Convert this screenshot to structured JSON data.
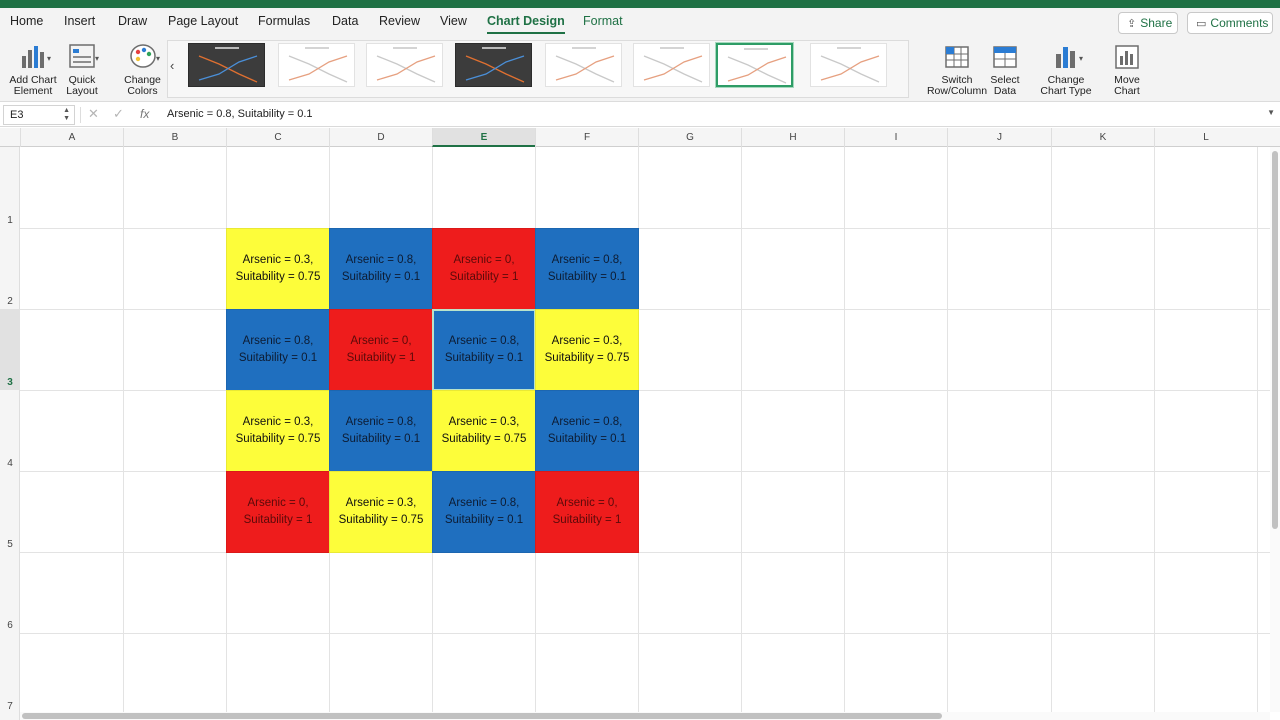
{
  "tabs": [
    "Home",
    "Insert",
    "Draw",
    "Page Layout",
    "Formulas",
    "Data",
    "Review",
    "View",
    "Chart Design",
    "Format"
  ],
  "active_tab": "Chart Design",
  "share_label": "Share",
  "comments_label": "Comments",
  "ribbon": {
    "add_chart_element": "Add Chart\nElement",
    "quick_layout": "Quick\nLayout",
    "change_colors": "Change\nColors",
    "switch_row_column": "Switch\nRow/Column",
    "select_data": "Select\nData",
    "change_chart_type": "Change\nChart Type",
    "move_chart": "Move\nChart"
  },
  "chart_style_thumbnails": [
    {
      "theme": "dark"
    },
    {
      "theme": "light"
    },
    {
      "theme": "light"
    },
    {
      "theme": "dark"
    },
    {
      "theme": "light"
    },
    {
      "theme": "light"
    },
    {
      "theme": "light",
      "selected": true
    },
    {
      "theme": "light"
    }
  ],
  "formula_bar": {
    "name_box": "E3",
    "formula": "Arsenic = 0.8, Suitability = 0.1"
  },
  "columns": [
    "A",
    "B",
    "C",
    "D",
    "E",
    "F",
    "G",
    "H",
    "I",
    "J",
    "K",
    "L"
  ],
  "rows": [
    "1",
    "2",
    "3",
    "4",
    "5",
    "6",
    "7"
  ],
  "selected_cell": {
    "column": "E",
    "row": "3"
  },
  "colors": {
    "yellow": "#fdfd3a",
    "blue": "#1f6fbf",
    "red": "#ee1c1c",
    "accent": "#1f7145"
  },
  "cells": [
    [
      {
        "text": "Arsenic = 0.3,\nSuitability = 0.75",
        "color": "yellow"
      },
      {
        "text": "Arsenic = 0.8,\nSuitability = 0.1",
        "color": "blue"
      },
      {
        "text": "Arsenic = 0,\nSuitability = 1",
        "color": "red"
      },
      {
        "text": "Arsenic = 0.8,\nSuitability = 0.1",
        "color": "blue"
      }
    ],
    [
      {
        "text": "Arsenic = 0.8,\nSuitability = 0.1",
        "color": "blue"
      },
      {
        "text": "Arsenic = 0,\nSuitability = 1",
        "color": "red"
      },
      {
        "text": "Arsenic = 0.8,\nSuitability = 0.1",
        "color": "blue"
      },
      {
        "text": "Arsenic = 0.3,\nSuitability = 0.75",
        "color": "yellow"
      }
    ],
    [
      {
        "text": "Arsenic = 0.3,\nSuitability = 0.75",
        "color": "yellow"
      },
      {
        "text": "Arsenic = 0.8,\nSuitability = 0.1",
        "color": "blue"
      },
      {
        "text": "Arsenic = 0.3,\nSuitability = 0.75",
        "color": "yellow"
      },
      {
        "text": "Arsenic = 0.8,\nSuitability = 0.1",
        "color": "blue"
      }
    ],
    [
      {
        "text": "Arsenic = 0,\nSuitability = 1",
        "color": "red"
      },
      {
        "text": "Arsenic = 0.3,\nSuitability = 0.75",
        "color": "yellow"
      },
      {
        "text": "Arsenic = 0.8,\nSuitability = 0.1",
        "color": "blue"
      },
      {
        "text": "Arsenic = 0,\nSuitability = 1",
        "color": "red"
      }
    ]
  ]
}
